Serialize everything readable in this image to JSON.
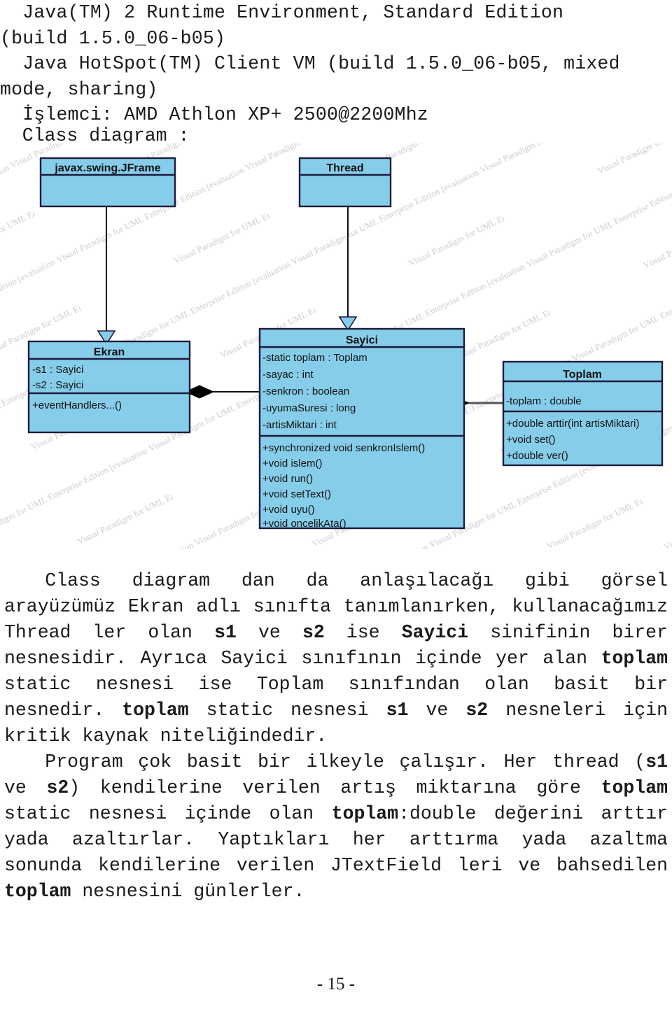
{
  "console": {
    "lines": [
      "  Java(TM) 2 Runtime Environment, Standard Edition",
      "(build 1.5.0_06-b05)",
      "  Java HotSpot(TM) Client VM (build 1.5.0_06-b05, mixed",
      "mode, sharing)",
      "  İşlemci: AMD Athlon XP+ 2500@2200Mhz"
    ]
  },
  "section_label": "  Class diagram :",
  "diagram": {
    "watermark_text": "Visual Paradigm for UML Enterprise Edition [evaluation copy]",
    "fill_color": "#86cdea",
    "border_color": "#1c1c3c",
    "classes": [
      {
        "id": "jframe",
        "name": "javax.swing.JFrame",
        "attributes": [],
        "operations": []
      },
      {
        "id": "thread",
        "name": "Thread",
        "attributes": [],
        "operations": []
      },
      {
        "id": "ekran",
        "name": "Ekran",
        "attributes": [
          "-s1 : Sayici",
          "-s2 : Sayici"
        ],
        "operations": [
          "+eventHandlers...()"
        ]
      },
      {
        "id": "sayici",
        "name": "Sayici",
        "attributes": [
          "-static toplam : Toplam",
          "-sayac : int",
          "-senkron : boolean",
          "-uyumaSuresi : long",
          "-artisMiktari : int"
        ],
        "operations": [
          "+synchronized void senkronIslem()",
          "+void islem()",
          "+void run()",
          "+void setText()",
          "+void uyu()",
          "+void oncelikAta()"
        ]
      },
      {
        "id": "toplam",
        "name": "Toplam",
        "attributes": [
          "-toplam : double"
        ],
        "operations": [
          "+double arttir(int artisMiktari)",
          "+void set()",
          "+double ver()"
        ]
      }
    ],
    "relations": [
      {
        "type": "generalization",
        "from": "jframe",
        "to": "ekran"
      },
      {
        "type": "generalization",
        "from": "thread",
        "to": "sayici"
      },
      {
        "type": "composition",
        "from": "ekran",
        "to": "sayici"
      },
      {
        "type": "composition",
        "from": "sayici",
        "to": "toplam"
      }
    ]
  },
  "paragraphs": [
    {
      "id": "p1",
      "runs": [
        {
          "t": "indent"
        },
        {
          "t": "text",
          "v": "Class diagram dan da anlaşılacağı gibi görsel arayüzümüz Ekran adlı sınıfta tanımlanırken, kullanacağımız Thread ler olan "
        },
        {
          "t": "bold",
          "v": "s1"
        },
        {
          "t": "text",
          "v": " ve "
        },
        {
          "t": "bold",
          "v": "s2"
        },
        {
          "t": "text",
          "v": " ise "
        },
        {
          "t": "bold",
          "v": "Sayici"
        },
        {
          "t": "text",
          "v": " sinifinin birer nesnesidir. Ayrıca Sayici sınıfının içinde yer alan "
        },
        {
          "t": "bold",
          "v": "toplam"
        },
        {
          "t": "text",
          "v": " static nesnesi ise Toplam sınıfından olan basit bir nesnedir. "
        },
        {
          "t": "bold",
          "v": "toplam"
        },
        {
          "t": "text",
          "v": " static nesnesi "
        },
        {
          "t": "bold",
          "v": "s1"
        },
        {
          "t": "text",
          "v": " ve "
        },
        {
          "t": "bold",
          "v": "s2"
        },
        {
          "t": "text",
          "v": " nesneleri için kritik kaynak niteliğindedir."
        }
      ]
    },
    {
      "id": "p2",
      "runs": [
        {
          "t": "indent"
        },
        {
          "t": "text",
          "v": "Program çok basit bir ilkeyle çalışır. Her thread ("
        },
        {
          "t": "bold",
          "v": "s1"
        },
        {
          "t": "text",
          "v": " ve "
        },
        {
          "t": "bold",
          "v": "s2"
        },
        {
          "t": "text",
          "v": ") kendilerine verilen artış miktarına göre "
        },
        {
          "t": "bold",
          "v": "toplam"
        },
        {
          "t": "text",
          "v": " static nesnesi içinde olan "
        },
        {
          "t": "bold",
          "v": "toplam"
        },
        {
          "t": "text",
          "v": ":double değerini arttır yada azaltırlar. Yaptıkları her arttırma yada azaltma sonunda kendilerine verilen JTextField leri ve bahsedilen "
        },
        {
          "t": "bold",
          "v": "toplam"
        },
        {
          "t": "text",
          "v": " nesnesini günlerler."
        }
      ]
    }
  ],
  "footer": {
    "page_number": "- 15 -"
  }
}
